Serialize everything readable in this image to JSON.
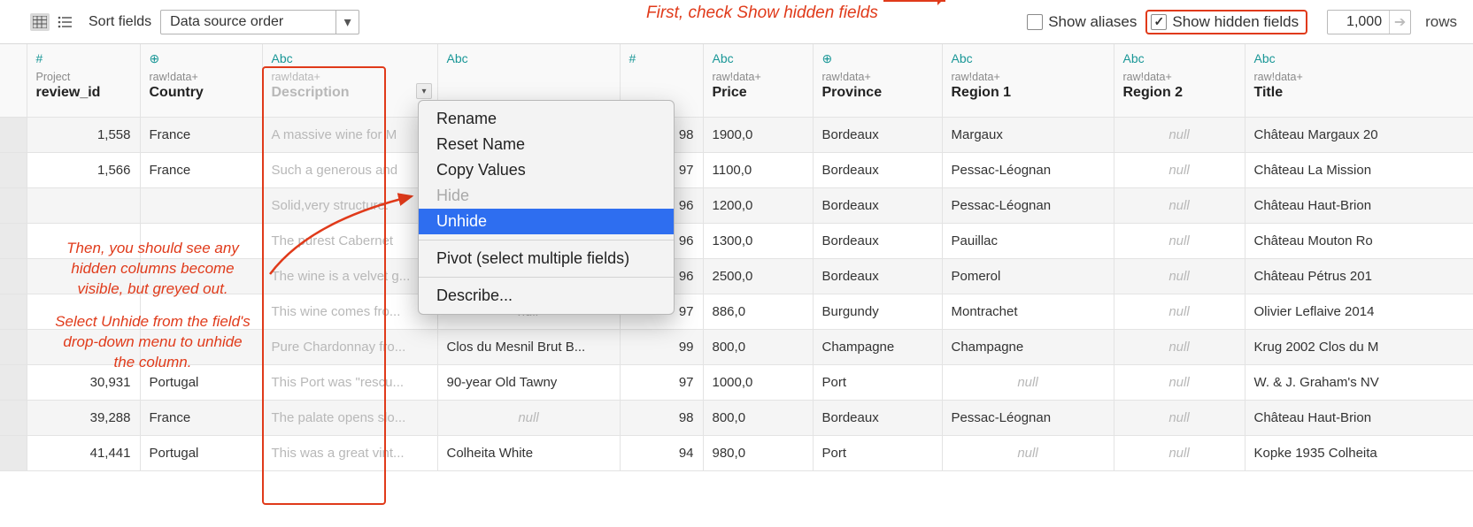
{
  "toolbar": {
    "sort_label": "Sort fields",
    "sort_value": "Data source order",
    "show_aliases_label": "Show aliases",
    "show_aliases_checked": false,
    "show_hidden_label": "Show hidden fields",
    "show_hidden_checked": true,
    "rows_value": "1,000",
    "rows_label": "rows"
  },
  "annotations": {
    "top": "First, check Show hidden fields",
    "left_1": "Then, you should see any hidden columns become visible, but greyed out.",
    "left_2": "Select Unhide from the field's drop-down menu to unhide the column."
  },
  "columns": [
    {
      "icon": "hash",
      "src": "Project",
      "name": "review_id",
      "hidden": false,
      "align": "num"
    },
    {
      "icon": "globe",
      "src": "raw!data+",
      "name": "Country",
      "hidden": false
    },
    {
      "icon": "abc",
      "src": "raw!data+",
      "name": "Description",
      "hidden": true
    },
    {
      "icon": "abc",
      "src": "",
      "name": "",
      "hidden": false
    },
    {
      "icon": "hash",
      "src": "",
      "name": "",
      "hidden": false,
      "align": "num"
    },
    {
      "icon": "abc",
      "src": "raw!data+",
      "name": "Price",
      "hidden": false
    },
    {
      "icon": "globe",
      "src": "raw!data+",
      "name": "Province",
      "hidden": false
    },
    {
      "icon": "abc",
      "src": "raw!data+",
      "name": "Region 1",
      "hidden": false
    },
    {
      "icon": "abc",
      "src": "raw!data+",
      "name": "Region 2",
      "hidden": false
    },
    {
      "icon": "abc",
      "src": "raw!data+",
      "name": "Title",
      "hidden": false
    }
  ],
  "col_header_icons": {
    "hash": "#",
    "globe": "⊕",
    "abc": "Abc"
  },
  "context_menu": {
    "items": [
      {
        "label": "Rename"
      },
      {
        "label": "Reset Name"
      },
      {
        "label": "Copy Values"
      },
      {
        "label": "Hide",
        "disabled": true
      },
      {
        "label": "Unhide",
        "highlight": true
      },
      {
        "sep": true
      },
      {
        "label": "Pivot (select multiple fields)"
      },
      {
        "sep": true
      },
      {
        "label": "Describe..."
      }
    ]
  },
  "rows": [
    {
      "review_id": "1,558",
      "country": "France",
      "desc": "A massive wine for M",
      "desig": "",
      "points": "98",
      "price": "1900,0",
      "province": "Bordeaux",
      "reg1": "Margaux",
      "reg2": "null",
      "title": "Château Margaux 20"
    },
    {
      "review_id": "1,566",
      "country": "France",
      "desc": "Such a generous and",
      "desig": "",
      "points": "97",
      "price": "1100,0",
      "province": "Bordeaux",
      "reg1": "Pessac-Léognan",
      "reg2": "null",
      "title": "Château La Mission"
    },
    {
      "review_id": "",
      "country": "",
      "desc": "Solid,very structure.",
      "desig": "",
      "points": "96",
      "price": "1200,0",
      "province": "Bordeaux",
      "reg1": "Pessac-Léognan",
      "reg2": "null",
      "title": "Château Haut-Brion"
    },
    {
      "review_id": "",
      "country": "",
      "desc": "The purest Cabernet",
      "desig": "",
      "points": "96",
      "price": "1300,0",
      "province": "Bordeaux",
      "reg1": "Pauillac",
      "reg2": "null",
      "title": "Château Mouton Ro"
    },
    {
      "review_id": "",
      "country": "",
      "desc": "The wine is a velvet g...",
      "desig": "null",
      "points": "96",
      "price": "2500,0",
      "province": "Bordeaux",
      "reg1": "Pomerol",
      "reg2": "null",
      "title": "Château Pétrus 201"
    },
    {
      "review_id": "",
      "country": "",
      "desc": "This wine comes fro...",
      "desig": "null",
      "points": "97",
      "price": "886,0",
      "province": "Burgundy",
      "reg1": "Montrachet",
      "reg2": "null",
      "title": "Olivier Leflaive 2014"
    },
    {
      "review_id": "",
      "country": "",
      "desc": "Pure Chardonnay fro...",
      "desig": "Clos du Mesnil Brut B...",
      "points": "99",
      "price": "800,0",
      "province": "Champagne",
      "reg1": "Champagne",
      "reg2": "null",
      "title": "Krug 2002 Clos du M"
    },
    {
      "review_id": "30,931",
      "country": "Portugal",
      "desc": "This Port was \"rescu...",
      "desig": "90-year Old Tawny",
      "points": "97",
      "price": "1000,0",
      "province": "Port",
      "reg1": "null",
      "reg2": "null",
      "title": "W. & J. Graham's NV"
    },
    {
      "review_id": "39,288",
      "country": "France",
      "desc": "The palate opens slo...",
      "desig": "null",
      "points": "98",
      "price": "800,0",
      "province": "Bordeaux",
      "reg1": "Pessac-Léognan",
      "reg2": "null",
      "title": "Château Haut-Brion"
    },
    {
      "review_id": "41,441",
      "country": "Portugal",
      "desc": "This was a great vint...",
      "desig": "Colheita White",
      "points": "94",
      "price": "980,0",
      "province": "Port",
      "reg1": "null",
      "reg2": "null",
      "title": "Kopke 1935 Colheita"
    }
  ]
}
